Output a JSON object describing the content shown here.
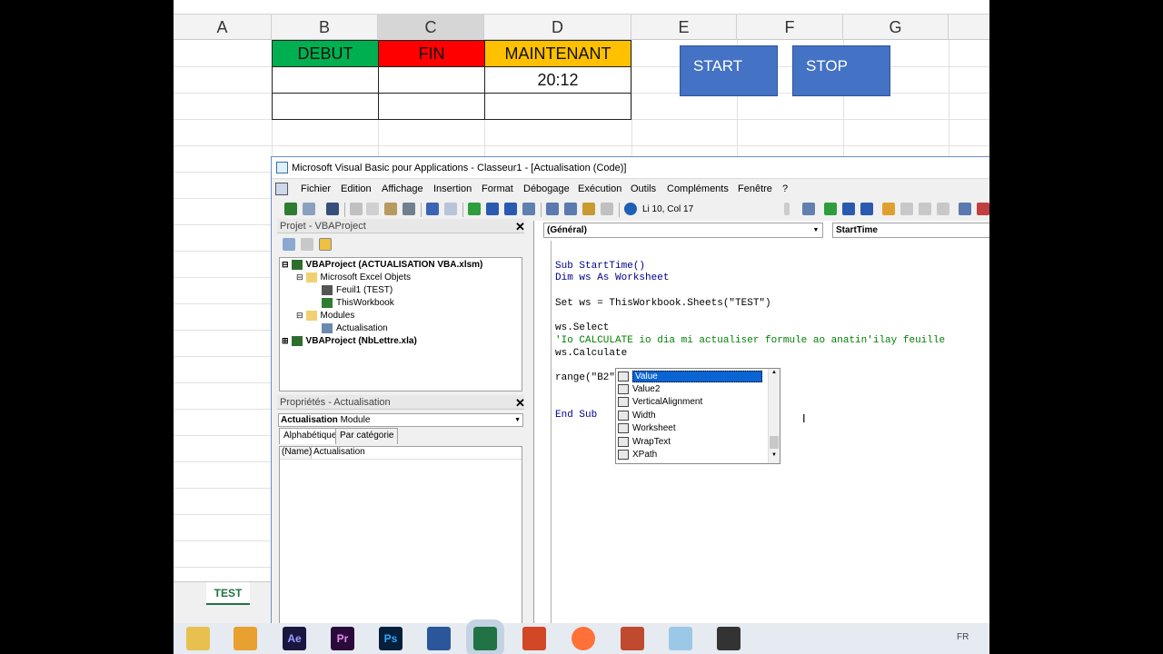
{
  "excel": {
    "columns": [
      "A",
      "B",
      "C",
      "D",
      "E",
      "F",
      "G"
    ],
    "headers": {
      "debut": "DEBUT",
      "fin": "FIN",
      "maintenant": "MAINTENANT"
    },
    "maintenant_value": "20:12",
    "start_button": "START",
    "stop_button": "STOP",
    "sheet_tab": "TEST",
    "colors": {
      "debut": "#00b050",
      "fin": "#ff0000",
      "maintenant": "#ffc000",
      "button": "#4472c4"
    }
  },
  "vbe": {
    "title": "Microsoft Visual Basic pour Applications - Classeur1 - [Actualisation (Code)]",
    "menu": [
      "Fichier",
      "Edition",
      "Affichage",
      "Insertion",
      "Format",
      "Débogage",
      "Exécution",
      "Outils",
      "Compléments",
      "Fenêtre",
      "?"
    ],
    "cursor_position": "Li 10, Col 17",
    "project_panel_title": "Projet - VBAProject",
    "tree": [
      "VBAProject (ACTUALISATION VBA.xlsm)",
      "Microsoft Excel Objets",
      "Feuil1 (TEST)",
      "ThisWorkbook",
      "Modules",
      "Actualisation",
      "VBAProject (NbLettre.xla)"
    ],
    "properties_title": "Propriétés - Actualisation",
    "properties_object": "Actualisation",
    "properties_object_type": "Module",
    "properties_tabs": [
      "Alphabétique",
      "Par catégorie"
    ],
    "properties_row": {
      "name": "(Name)",
      "value": "Actualisation"
    },
    "object_dropdown": "(Général)",
    "procedure_dropdown": "StartTime",
    "code_lines": [
      "Sub StartTime()",
      "Dim ws As Worksheet",
      "",
      "Set ws = ThisWorkbook.Sheets(\"TEST\")",
      "",
      "ws.Select",
      "'Io CALCULATE io dia mi actualiser formule ao anatin'ilay feuille",
      "ws.Calculate",
      "",
      "range(\"B2\").valu",
      "",
      "",
      "End Sub"
    ],
    "intellisense": [
      "Value",
      "Value2",
      "VerticalAlignment",
      "Width",
      "Worksheet",
      "WrapText",
      "XPath"
    ]
  },
  "taskbar": {
    "apps": [
      "file-explorer-icon",
      "media-player-icon",
      "after-effects-icon",
      "premiere-icon",
      "photoshop-icon",
      "word-icon",
      "excel-icon",
      "powerpoint-icon",
      "firefox-icon",
      "app-icon",
      "notepad-icon",
      "camera-icon"
    ],
    "labels": {
      "ae": "Ae",
      "pr": "Pr",
      "ps": "Ps"
    },
    "lang": "FR"
  }
}
